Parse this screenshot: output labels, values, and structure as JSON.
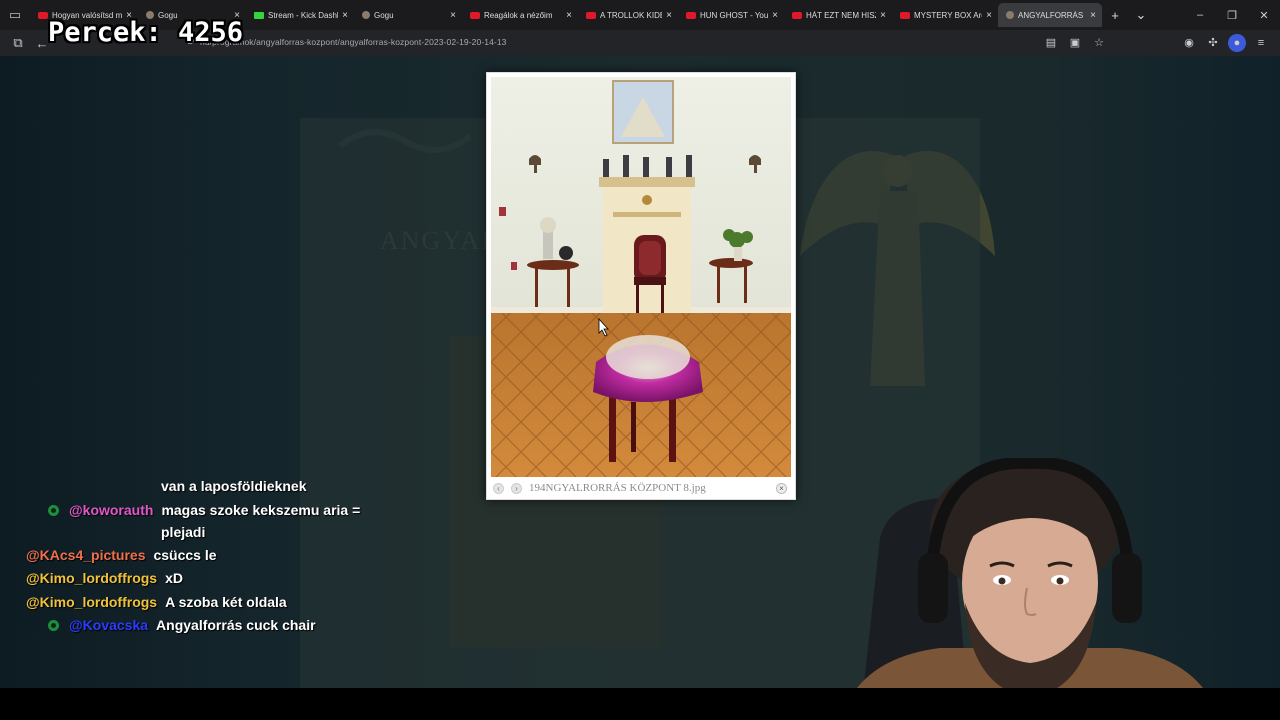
{
  "overlay": {
    "counter_text": "Percek: 4256"
  },
  "browser": {
    "tabs": [
      {
        "title": "Hogyan valósítsd m",
        "favicon": "youtube-icon",
        "active": false
      },
      {
        "title": "Gogu",
        "favicon": "avatar-icon",
        "active": false
      },
      {
        "title": "Stream - Kick Dashb",
        "favicon": "kick-icon",
        "active": false
      },
      {
        "title": "Gogu",
        "favicon": "avatar-icon",
        "active": false
      },
      {
        "title": "Reagálok a nézőim",
        "favicon": "youtube-icon",
        "active": false
      },
      {
        "title": "A TROLLOK KIDERÍT",
        "favicon": "youtube-icon",
        "active": false
      },
      {
        "title": "HUN GHOST - YouT",
        "favicon": "youtube-icon",
        "active": false
      },
      {
        "title": "HÁT EZT NEM HISZ",
        "favicon": "youtube-icon",
        "active": false
      },
      {
        "title": "MYSTERY BOX Arch",
        "favicon": "youtube-icon",
        "active": false
      },
      {
        "title": "ANGYALFORRÁS KÖZP",
        "favicon": "site-icon",
        "active": true
      }
    ],
    "url": "hu/programok/angyalforras-kozpont/angyalforras-kozpont-2023-02-19-20-14-13"
  },
  "lightbox": {
    "caption": "194NGYALRORRÁS KÖZPONT 8.jpg",
    "prev_label": "‹",
    "next_label": "›",
    "close_label": "×"
  },
  "chat": {
    "messages": [
      {
        "user": "",
        "text": "van a laposföldieknek",
        "user_color": "#ffffff",
        "badge": false
      },
      {
        "user": "@koworauth",
        "text": "magas szoke kekszemu aria =",
        "user_color": "#e058c8",
        "badge": true
      },
      {
        "user": "",
        "text": "plejadi",
        "user_color": "#ffffff",
        "badge": false
      },
      {
        "user": "@KAcs4_pictures",
        "text": "csüccs le",
        "user_color": "#f0704c",
        "badge": false
      },
      {
        "user": "@Kimo_lordoffrogs",
        "text": "xD",
        "user_color": "#f0c23a",
        "badge": false
      },
      {
        "user": "@Kimo_lordoffrogs",
        "text": "A szoba két oldala",
        "user_color": "#f0c23a",
        "badge": false
      },
      {
        "user": "@Kovacska",
        "text": "Angyalforrás cuck chair",
        "user_color": "#2a3cff",
        "badge": true
      }
    ]
  },
  "colors": {
    "youtube": "#e1182b",
    "kick": "#33d43c",
    "chat_green_badge": "#1e8e3e"
  }
}
